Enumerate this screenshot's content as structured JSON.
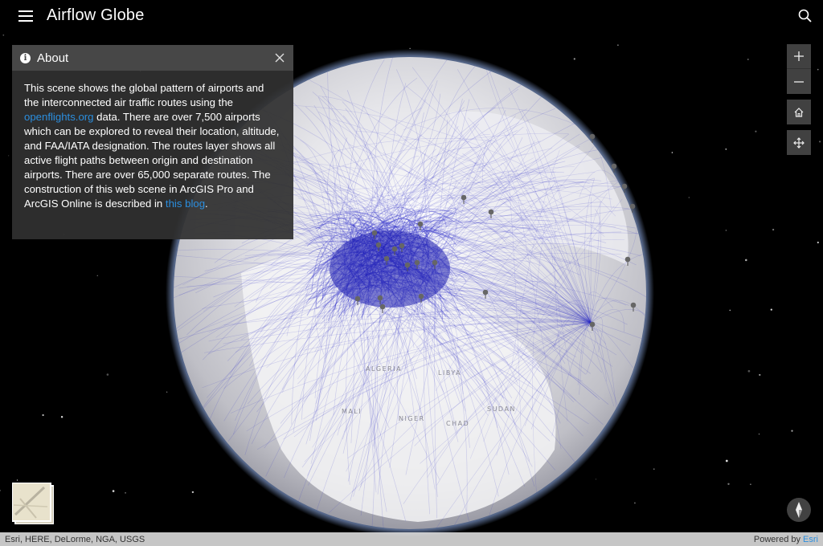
{
  "app": {
    "title": "Airflow Globe"
  },
  "about": {
    "title": "About",
    "text_1": "This scene shows the global pattern of airports and the interconnected air traffic routes using the ",
    "link_1": "openflights.org",
    "text_2": " data. There are over 7,500 airports which can be explored to reveal their location, altitude, and FAA/IATA designation. The routes layer shows all active flight paths between origin and destination airports. There are over 65,000 separate routes. The construction of this web scene in ArcGIS Pro and ArcGIS Online is described in ",
    "link_2": "this blog",
    "text_3": "."
  },
  "map_labels": {
    "algeria": "ALGERIA",
    "libya": "LIBYA",
    "niger": "NIGER",
    "chad": "CHAD",
    "mali": "MALI",
    "sudan": "SUDAN"
  },
  "controls": {
    "zoom_in": "+",
    "zoom_out": "−",
    "icons": [
      "menu-icon",
      "search-icon",
      "info-icon",
      "close-icon",
      "zoom-in-icon",
      "zoom-out-icon",
      "home-icon",
      "pan-icon",
      "compass-icon"
    ]
  },
  "attribution": {
    "sources": "Esri, HERE, DeLorme, NGA, USGS",
    "powered_prefix": "Powered by ",
    "powered_link": "Esri"
  },
  "colors": {
    "background": "#000000",
    "routes": "#2a2ac8",
    "link": "#2b8ede",
    "panel": "#303030"
  }
}
